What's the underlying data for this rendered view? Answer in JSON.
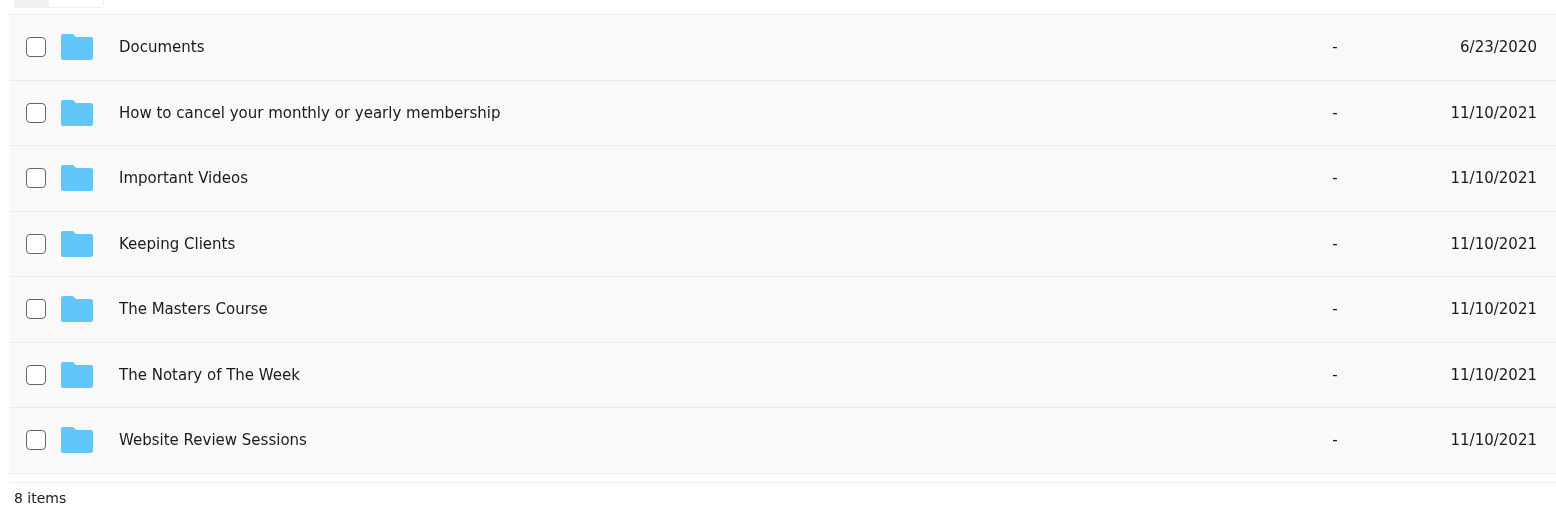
{
  "rows": [
    {
      "name": "Documents",
      "size": "-",
      "date": "6/23/2020",
      "checked": false
    },
    {
      "name": "How to cancel your monthly or yearly membership",
      "size": "-",
      "date": "11/10/2021",
      "checked": false
    },
    {
      "name": "Important Videos",
      "size": "-",
      "date": "11/10/2021",
      "checked": false
    },
    {
      "name": "Keeping Clients",
      "size": "-",
      "date": "11/10/2021",
      "checked": false
    },
    {
      "name": "The Masters Course",
      "size": "-",
      "date": "11/10/2021",
      "checked": false
    },
    {
      "name": "The Notary of The Week",
      "size": "-",
      "date": "11/10/2021",
      "checked": false
    },
    {
      "name": "Website Review Sessions",
      "size": "-",
      "date": "11/10/2021",
      "checked": false
    }
  ],
  "footer": {
    "count": "8 items"
  }
}
